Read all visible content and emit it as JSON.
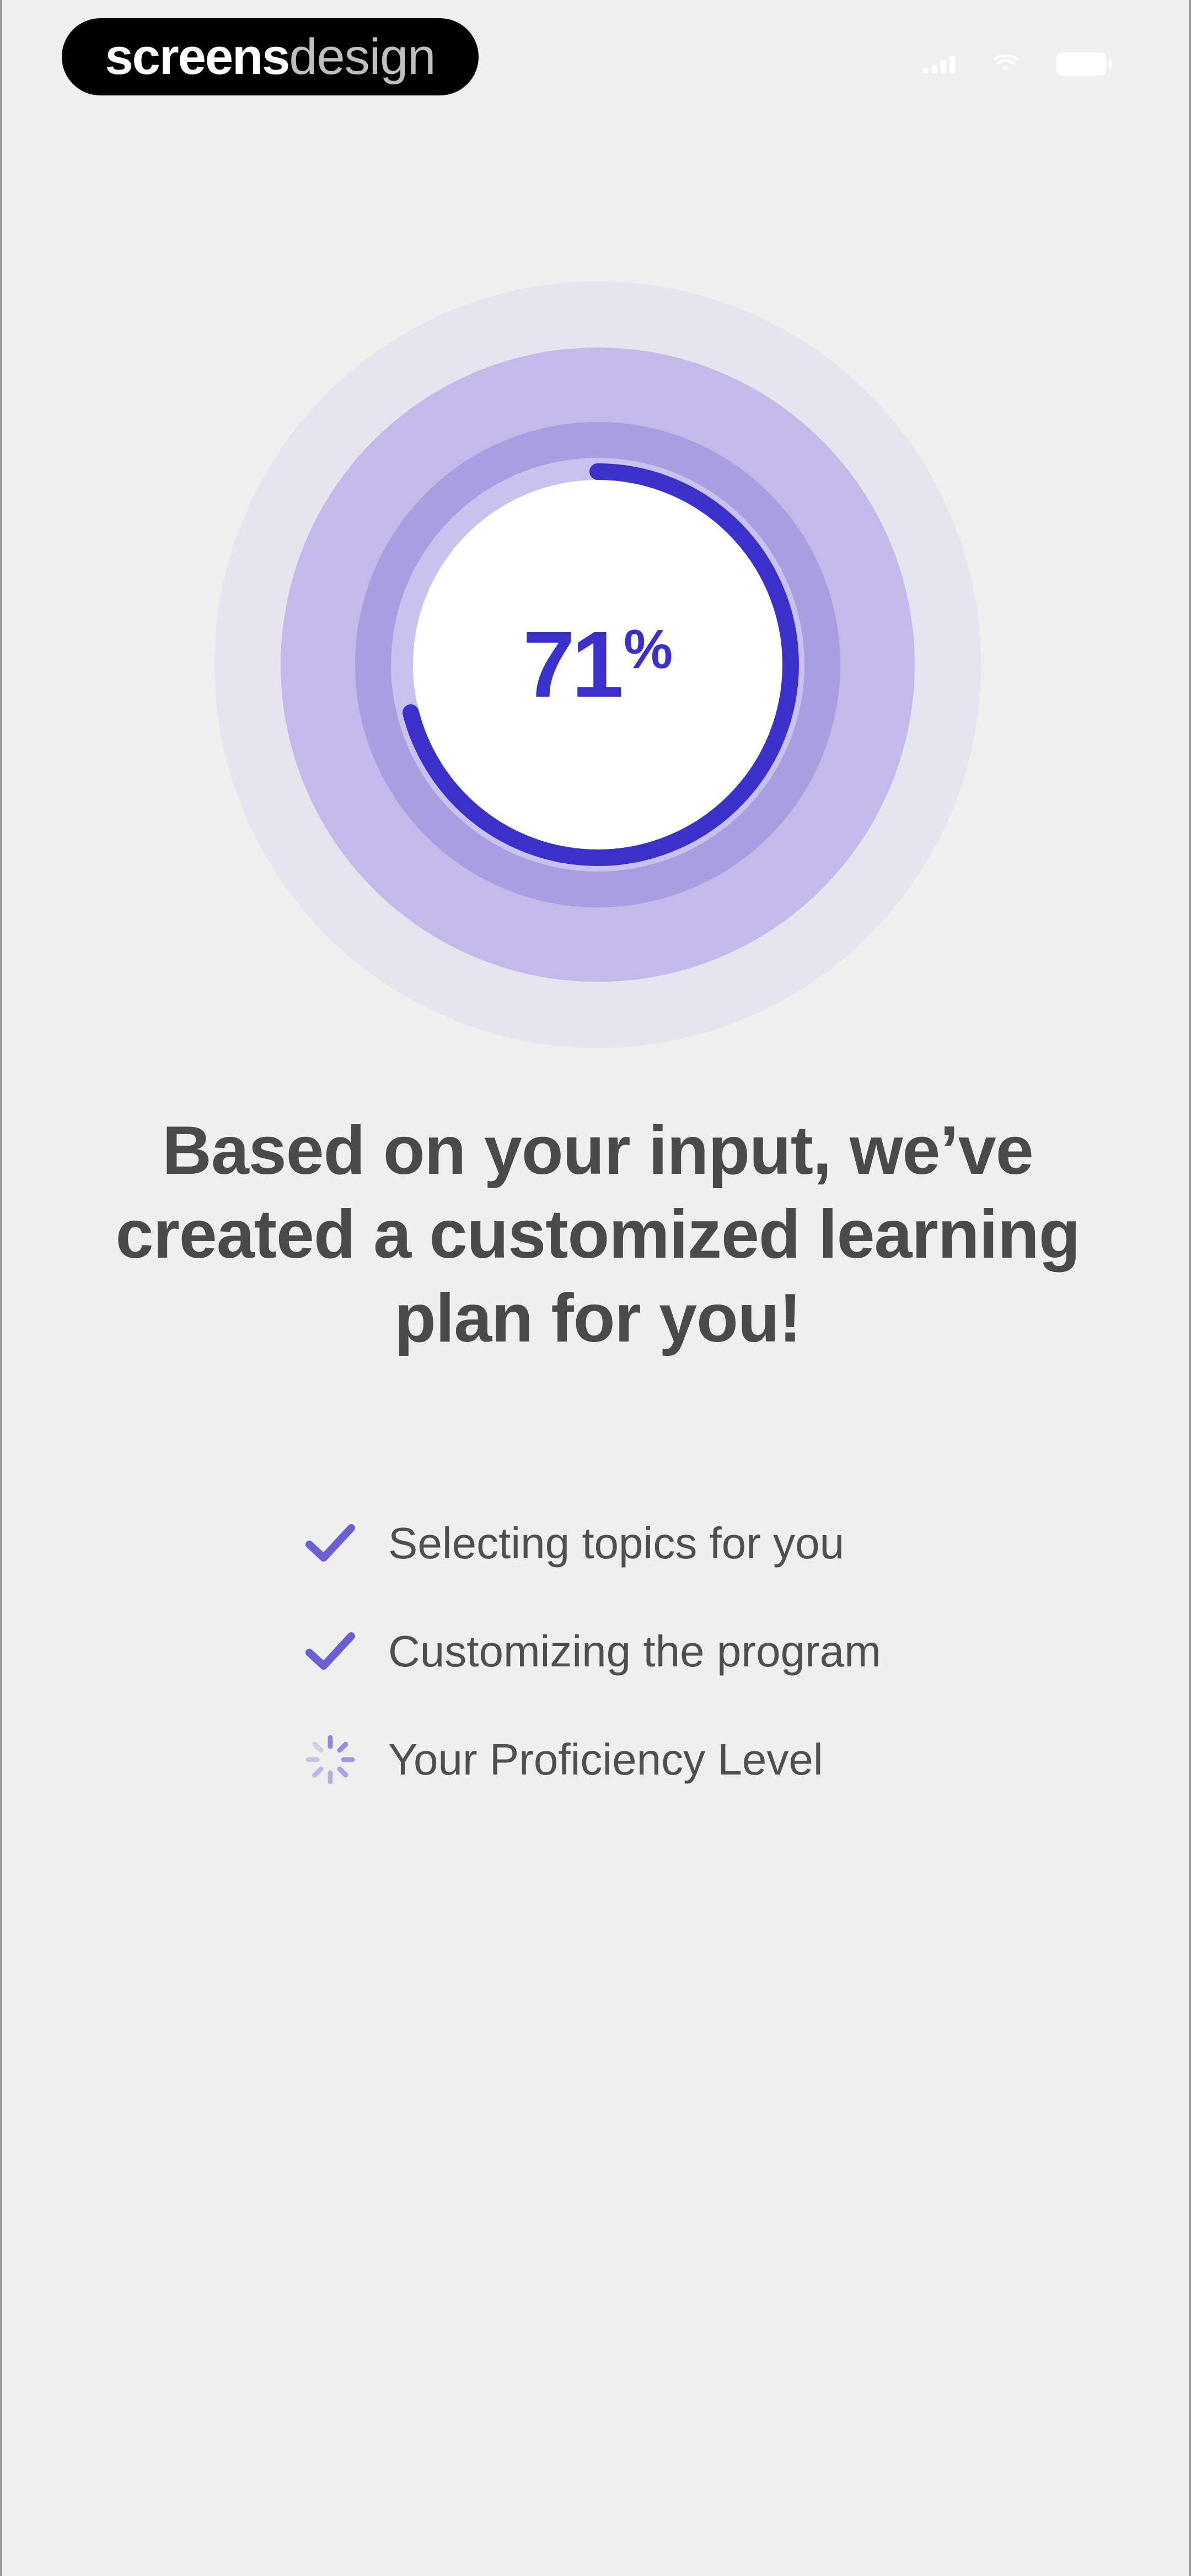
{
  "brand": {
    "part1": "screens",
    "part2": "design"
  },
  "status": {
    "icons": [
      "signal-icon",
      "wifi-icon",
      "battery-icon"
    ]
  },
  "progress": {
    "value": 71,
    "number": "71",
    "unit": "%"
  },
  "headline": "Based on your input, we’ve created a customized learning plan for you!",
  "steps": [
    {
      "label": "Selecting topics for you",
      "state": "done",
      "icon": "checkmark-icon"
    },
    {
      "label": "Customizing the program",
      "state": "done",
      "icon": "checkmark-icon"
    },
    {
      "label": "Your Proficiency Level",
      "state": "loading",
      "icon": "spinner-icon"
    }
  ],
  "colors": {
    "accent": "#3b30c9",
    "ring_outer": "#e6e4ee",
    "ring_mid": "#c4baea",
    "ring_inner": "#a99ee0",
    "check": "#6b5fd6",
    "text": "#4a4a4a",
    "background": "#efefef"
  }
}
